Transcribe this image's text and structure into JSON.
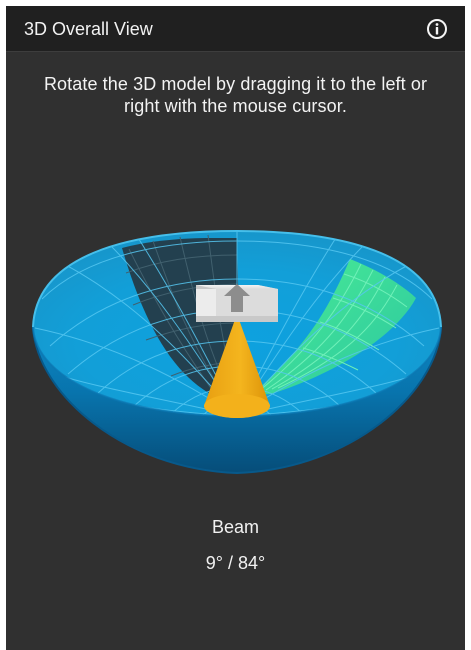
{
  "header": {
    "title": "3D Overall View",
    "info_icon": "info-icon"
  },
  "instructions": "Rotate the 3D model by dragging it to the left or right with the mouse cursor.",
  "beam": {
    "label": "Beam",
    "value": "9° / 84°"
  },
  "colors": {
    "panel_background": "#303030",
    "header_background": "#202020",
    "hemisphere_blue": "#1aa6de",
    "hemisphere_dark_blue": "#0b5f93",
    "shadow_wedge": "#203847",
    "green_sector": "#38e29b",
    "beam_cone": "#f2ac16",
    "source_box": "#e9e9e9",
    "arrow": "#8f8f8f"
  }
}
